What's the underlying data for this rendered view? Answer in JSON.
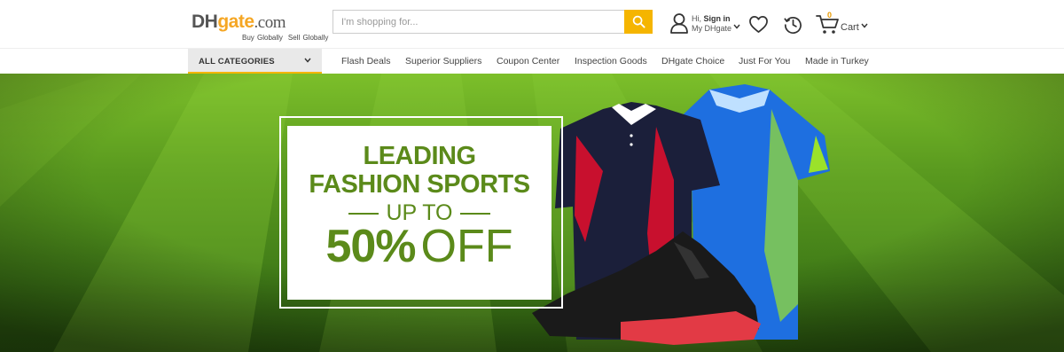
{
  "header": {
    "logo": {
      "dh": "DH",
      "gate": "gate",
      "com": ".com",
      "tag_buy": "Buy Globally",
      "tag_sell": "Sell Globally"
    },
    "search": {
      "placeholder": "I'm shopping for...",
      "value": "",
      "icon": "search-icon"
    },
    "account": {
      "hi": "Hi,",
      "sign_in": "Sign in",
      "my": "My DHgate"
    },
    "cart": {
      "count": "0",
      "label": "Cart"
    },
    "icons": [
      "user-icon",
      "heart-icon",
      "history-icon",
      "cart-icon"
    ]
  },
  "nav": {
    "all_categories": "ALL CATEGORIES",
    "links": [
      "Flash Deals",
      "Superior Suppliers",
      "Coupon Center",
      "Inspection Goods",
      "DHgate Choice",
      "Just For You",
      "Made in Turkey"
    ]
  },
  "banner": {
    "line1": "LEADING",
    "line2": "FASHION SPORTS",
    "upto": "UP TO",
    "percent": "50%",
    "off": "OFF",
    "colors": {
      "accent": "#f5b500",
      "promo_green": "#5b8a1a",
      "grass": "#4f8a1c"
    }
  }
}
